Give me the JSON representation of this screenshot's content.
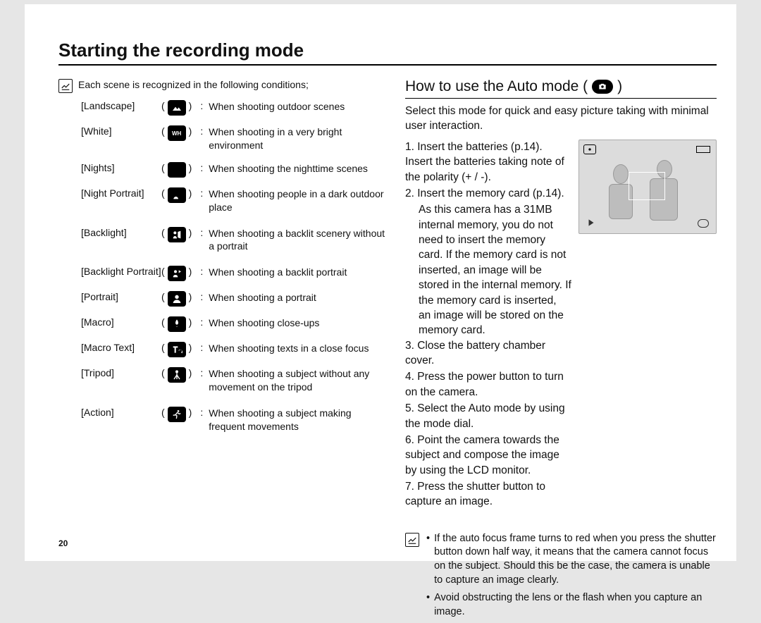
{
  "title": "Starting the recording mode",
  "intro": "Each scene is recognized in the following conditions;",
  "scenes": [
    {
      "name": "[Landscape]",
      "icon": "landscape-icon",
      "desc": "When shooting outdoor scenes"
    },
    {
      "name": "[White]",
      "icon": "white-icon",
      "icon_label": "WH",
      "desc": "When shooting in a very bright environment"
    },
    {
      "name": "[Nights]",
      "icon": "night-icon",
      "desc": "When shooting the nighttime scenes"
    },
    {
      "name": "[Night Portrait]",
      "icon": "night-portrait-icon",
      "desc": "When shooting people in a dark outdoor place"
    },
    {
      "name": "[Backlight]",
      "icon": "backlight-icon",
      "desc": "When shooting a backlit scenery without a portrait"
    },
    {
      "name": "[Backlight Portrait]",
      "icon": "backlight-portrait-icon",
      "desc": "When shooting a backlit portrait"
    },
    {
      "name": "[Portrait]",
      "icon": "portrait-icon",
      "desc": "When shooting a portrait"
    },
    {
      "name": "[Macro]",
      "icon": "macro-icon",
      "desc": "When shooting close-ups"
    },
    {
      "name": "[Macro Text]",
      "icon": "macro-text-icon",
      "desc": "When shooting texts in a close focus"
    },
    {
      "name": "[Tripod]",
      "icon": "tripod-icon",
      "desc": "When shooting a subject without any movement on the tripod"
    },
    {
      "name": "[Action]",
      "icon": "action-icon",
      "desc": "When shooting a subject making frequent movements"
    }
  ],
  "right": {
    "heading": "How to use the Auto mode (",
    "heading_close": ")",
    "intro": "Select this mode for quick and easy picture taking with minimal user interaction.",
    "step1": "1. Insert the batteries (p.14). Insert the batteries taking note of the polarity (+ / -).",
    "step2a": "2. Insert the memory card (p.14).",
    "step2b": "As this camera has a 31MB internal memory, you do not need to insert the memory card. If the memory card is not inserted, an image will be stored in the internal memory. If the memory card is inserted, an image will be stored on the memory card.",
    "step3": "3. Close the battery chamber cover.",
    "step4": "4. Press the power button to turn on the camera.",
    "step5": "5. Select the Auto mode by using the mode dial.",
    "step6": "6. Point the camera towards the subject and compose the image by using the LCD monitor.",
    "step7": "7. Press the shutter button to capture an image.",
    "notes": [
      "If the auto focus frame turns to red when you press the shutter button down half way, it means that the camera cannot focus on the subject. Should this be the case, the camera is unable to capture an image clearly.",
      "Avoid obstructing the lens or the flash when you capture an image."
    ]
  },
  "page_number": "20"
}
